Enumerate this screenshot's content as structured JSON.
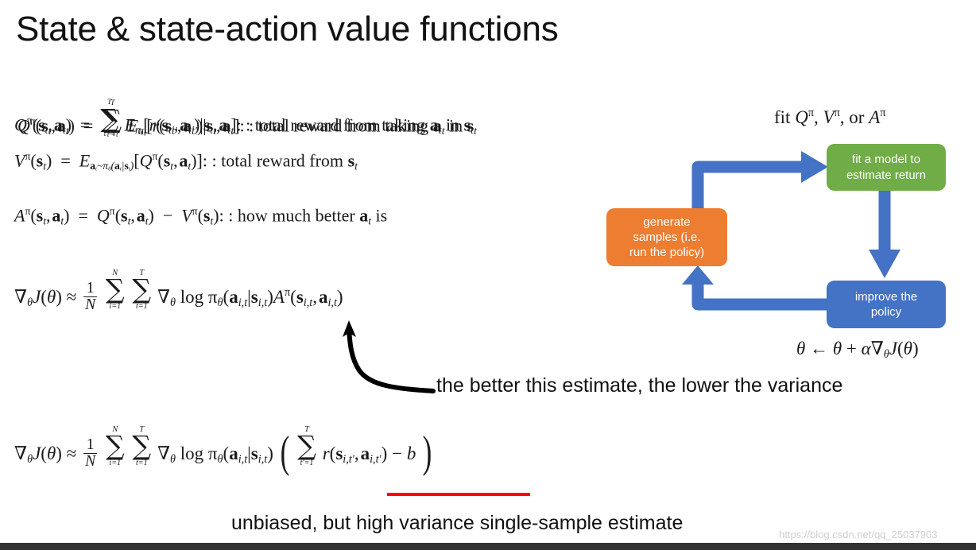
{
  "slide": {
    "title": "State & state-action value functions",
    "background": "#ffffff"
  },
  "equations": {
    "q_function": {
      "latex": "Q^{\\pi}(\\mathbf{s}_t,\\mathbf{a}_t) = \\sum_{t'=t}^{T} E_{\\pi_\\theta}[r(\\mathbf{s}_{t'},\\mathbf{a}_{t'})|\\mathbf{s}_t,\\mathbf{a}_t]",
      "caption": ": total reward from taking",
      "caption_tail": "in",
      "note": "rendered twice with a slight offset (overlapping animation layers)",
      "overlapped": true
    },
    "v_function": {
      "latex": "V^{\\pi}(\\mathbf{s}_t) = E_{\\mathbf{a}_t \\sim \\pi_\\theta(\\mathbf{a}_t|\\mathbf{s}_t)}[Q^{\\pi}(\\mathbf{s}_t,\\mathbf{a}_t)]",
      "caption": ": total reward from"
    },
    "a_function": {
      "latex": "A^{\\pi}(\\mathbf{s}_t,\\mathbf{a}_t) = Q^{\\pi}(\\mathbf{s}_t,\\mathbf{a}_t) - V^{\\pi}(\\mathbf{s}_t)",
      "caption": ": how much better",
      "caption_tail": "is"
    },
    "policy_gradient_advantage": {
      "latex": "\\nabla_\\theta J(\\theta) \\approx \\frac{1}{N}\\sum_{i=1}^{N}\\sum_{t=1}^{T} \\nabla_\\theta \\log \\pi_\\theta(\\mathbf{a}_{i,t}|\\mathbf{s}_{i,t}) A^{\\pi}(\\mathbf{s}_{i,t},\\mathbf{a}_{i,t})"
    },
    "policy_gradient_baseline": {
      "latex": "\\nabla_\\theta J(\\theta) \\approx \\frac{1}{N}\\sum_{i=1}^{N}\\sum_{t=1}^{T} \\nabla_\\theta \\log \\pi_\\theta(\\mathbf{a}_{i,t}|\\mathbf{s}_{i,t}) \\left( \\sum_{t'=1}^{T} r(\\mathbf{s}_{i,t'},\\mathbf{a}_{i,t'}) - b \\right)",
      "underline_color": "#ff0000"
    }
  },
  "symbols": {
    "N": "N",
    "T": "T",
    "b": "b",
    "one": "1",
    "i_eq_1": "i=1",
    "t_eq_1": "t=1",
    "tp_eq_1": "t'=1",
    "tp_eq_t": "t'=t"
  },
  "diagram": {
    "header_label": "fit Qπ, Vπ, or Aπ",
    "update_rule": "θ ← θ + α∇θJ(θ)",
    "boxes": [
      {
        "id": "fit-model",
        "lines": [
          "fit a model to",
          "estimate return"
        ],
        "color": "#70AD47"
      },
      {
        "id": "generate-samples",
        "lines": [
          "generate",
          "samples (i.e.",
          "run the policy)"
        ],
        "color": "#ED7D31"
      },
      {
        "id": "improve-policy",
        "lines": [
          "improve the",
          "policy"
        ],
        "color": "#4472C4"
      }
    ],
    "arrow_color": "#4472C4"
  },
  "annotations": {
    "variance_note": "the better this estimate, the lower the variance",
    "unbiased_note": "unbiased, but high variance single-sample estimate"
  },
  "watermark": {
    "text": "https://blog.csdn.net/qq_25037903",
    "color": "#cfcfcf"
  },
  "bottom_bar": {
    "color": "#333333"
  }
}
